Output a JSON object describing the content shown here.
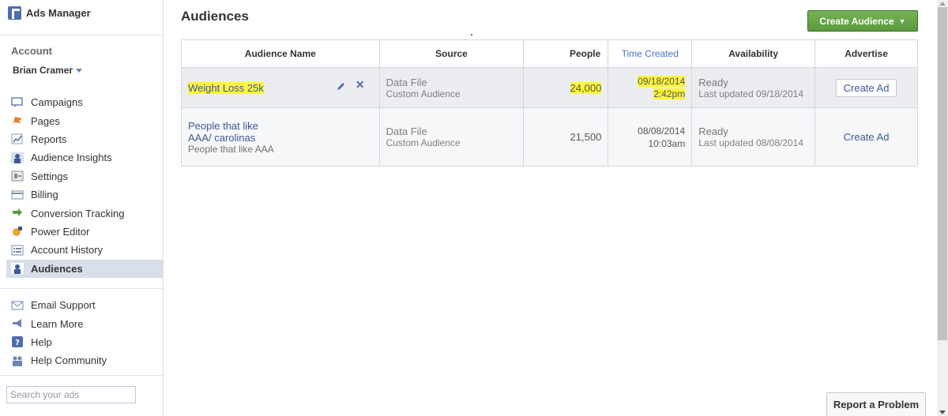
{
  "app": {
    "title": "Ads Manager"
  },
  "account": {
    "label": "Account",
    "name": "Brian Cramer"
  },
  "nav_primary": [
    {
      "label": "Campaigns",
      "icon": "campaigns-icon"
    },
    {
      "label": "Pages",
      "icon": "pages-flag-icon"
    },
    {
      "label": "Reports",
      "icon": "reports-chart-icon"
    },
    {
      "label": "Audience Insights",
      "icon": "audience-insights-icon"
    },
    {
      "label": "Settings",
      "icon": "settings-icon"
    },
    {
      "label": "Billing",
      "icon": "billing-card-icon"
    },
    {
      "label": "Conversion Tracking",
      "icon": "conversion-tracking-icon"
    },
    {
      "label": "Power Editor",
      "icon": "power-editor-icon"
    },
    {
      "label": "Account History",
      "icon": "account-history-icon"
    },
    {
      "label": "Audiences",
      "icon": "audiences-icon",
      "active": true
    }
  ],
  "nav_support": [
    {
      "label": "Email Support",
      "icon": "email-icon"
    },
    {
      "label": "Learn More",
      "icon": "megaphone-icon"
    },
    {
      "label": "Help",
      "icon": "help-icon"
    },
    {
      "label": "Help Community",
      "icon": "community-icon"
    }
  ],
  "search": {
    "placeholder": "Search your ads"
  },
  "main": {
    "title": "Audiences",
    "create_button": "Create Audience",
    "columns": [
      "Audience Name",
      "Source",
      "People",
      "Time Created",
      "Availability",
      "Advertise"
    ],
    "rows": [
      {
        "name": "Weight Loss 25k",
        "description": "",
        "source": "Data File",
        "source_type": "Custom Audience",
        "people": "24,000",
        "date": "09/18/2014",
        "time": "2:42pm",
        "status": "Ready",
        "updated": "Last updated 09/18/2014",
        "action": "Create Ad"
      },
      {
        "name_line1": "People that like",
        "name_line2": "AAA/ carolinas",
        "description": "People that like AAA",
        "source": "Data File",
        "source_type": "Custom Audience",
        "people": "21,500",
        "date": "08/08/2014",
        "time": "10:03am",
        "status": "Ready",
        "updated": "Last updated 08/08/2014",
        "action": "Create Ad"
      }
    ]
  },
  "footer": {
    "report_button": "Report a Problem"
  },
  "colors": {
    "accent": "#3b5998",
    "highlight": "#fcf53a",
    "create_green": "#69a74e",
    "sorted_header": "#4a74c7"
  }
}
